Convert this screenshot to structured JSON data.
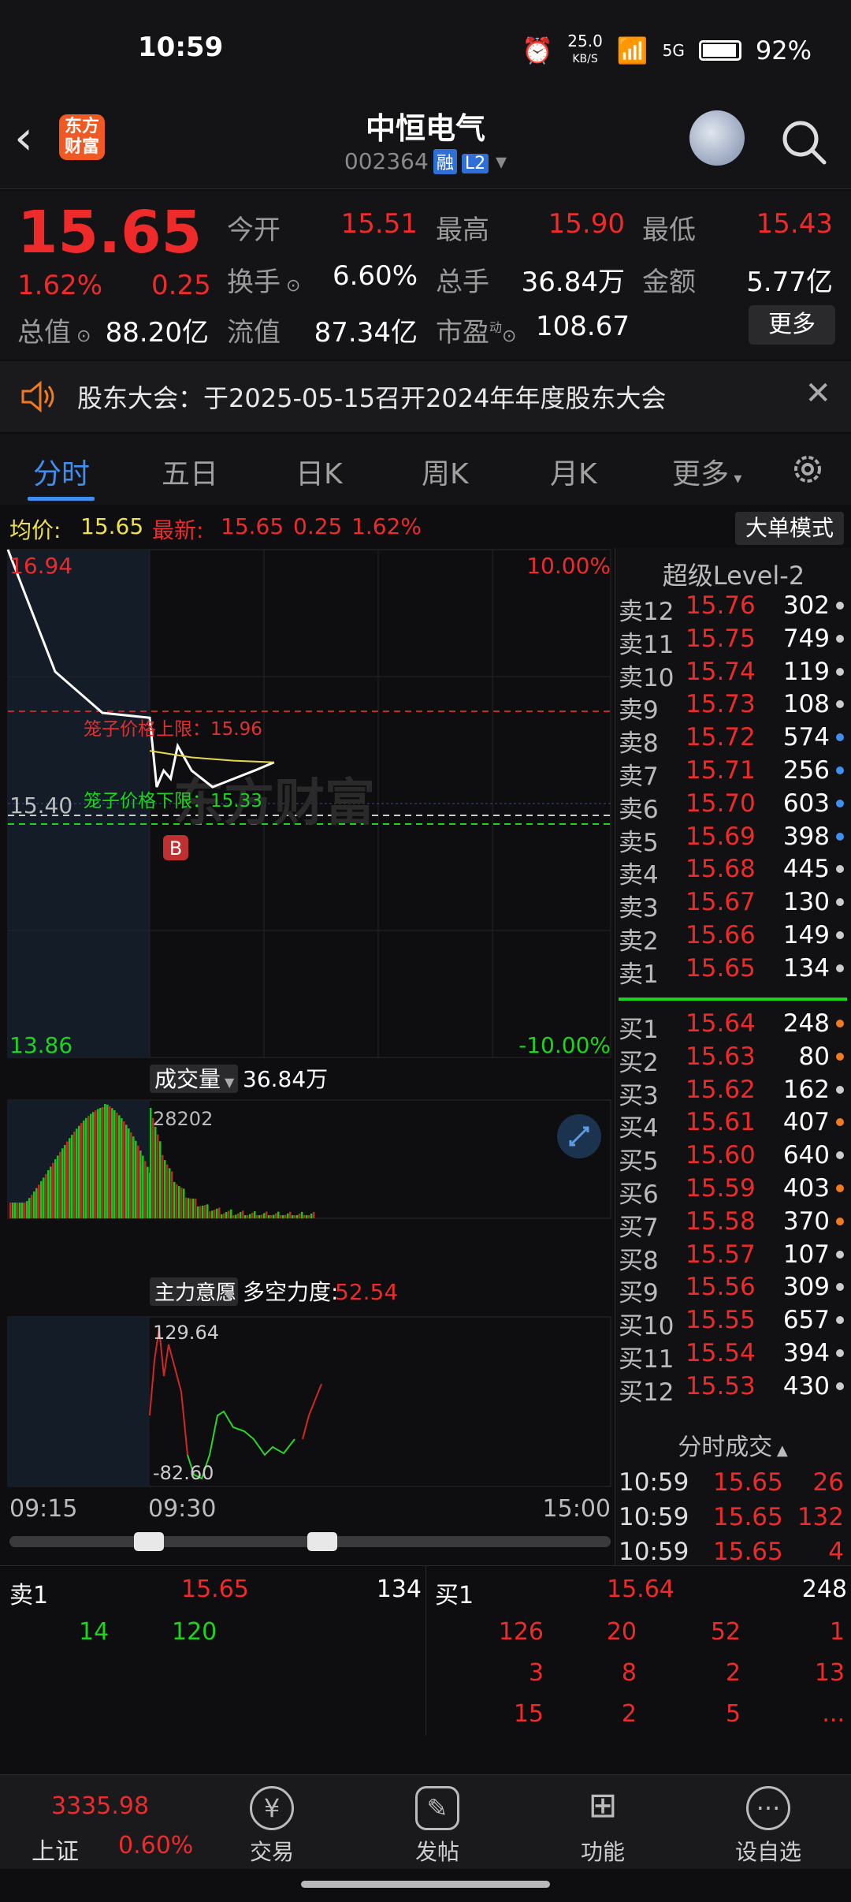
{
  "status_bar": {
    "time": "10:59",
    "net_speed": "25.0",
    "net_unit": "KB/S",
    "signal": "5G",
    "battery": "92%"
  },
  "header": {
    "name": "中恒电气",
    "code": "002364",
    "tag_rong": "融",
    "tag_l2": "L2",
    "logo_text": "东方财富"
  },
  "quote": {
    "price": "15.65",
    "pct": "1.62%",
    "change": "0.25",
    "open_label": "今开",
    "open": "15.51",
    "high_label": "最高",
    "high": "15.90",
    "low_label": "最低",
    "low": "15.43",
    "turnover_label": "换手",
    "turnover": "6.60%",
    "volume_label": "总手",
    "volume": "36.84万",
    "amount_label": "金额",
    "amount": "5.77亿",
    "mktcap_label": "总值",
    "mktcap": "88.20亿",
    "float_label": "流值",
    "float": "87.34亿",
    "pe_label": "市盈",
    "pe_sup": "动",
    "pe": "108.67",
    "more": "更多"
  },
  "notice": {
    "text": "股东大会：于2025-05-15召开2024年年度股东大会"
  },
  "tabs": [
    "分时",
    "五日",
    "日K",
    "周K",
    "月K",
    "更多"
  ],
  "info_row": {
    "avg_label": "均价:",
    "avg": "15.65",
    "latest_label": "最新:",
    "latest": "15.65",
    "chg": "0.25",
    "pct": "1.62%",
    "mode_button": "大单模式"
  },
  "chart": {
    "y_top": "16.94",
    "y_mid": "15.40",
    "y_bottom": "13.86",
    "pct_top": "10.00%",
    "pct_bottom": "-10.00%",
    "cage_upper": "笼子价格上限：15.96",
    "cage_lower": "笼子价格下限：15.33",
    "marker_b": "B",
    "watermark": "东方财富",
    "volume_label": "成交量",
    "volume_value": "36.84万",
    "volume_max": "28202",
    "force_label": "主力意愿",
    "force_title": "多空力度:",
    "force_value": "52.54",
    "force_max": "129.64",
    "force_min": "-82.60",
    "time_start": "09:15",
    "time_open": "09:30",
    "time_end": "15:00"
  },
  "chart_data": {
    "type": "line",
    "series": [
      {
        "name": "价格",
        "x": [
          "09:15",
          "09:20",
          "09:25",
          "09:30",
          "09:35",
          "09:40",
          "09:45",
          "09:50",
          "10:00",
          "10:15",
          "10:30",
          "10:45",
          "10:59"
        ],
        "values": [
          16.94,
          16.2,
          15.95,
          15.92,
          15.5,
          15.6,
          15.55,
          15.75,
          15.6,
          15.5,
          15.55,
          15.6,
          15.65
        ]
      },
      {
        "name": "均价",
        "x": [
          "09:30",
          "10:00",
          "10:30",
          "10:59"
        ],
        "values": [
          15.72,
          15.68,
          15.66,
          15.65
        ]
      }
    ],
    "ylim": [
      13.86,
      16.94
    ]
  },
  "order_book": {
    "title": "超级Level-2",
    "sell": [
      {
        "label": "卖12",
        "price": "15.76",
        "vol": "302",
        "dot": "#cccccc"
      },
      {
        "label": "卖11",
        "price": "15.75",
        "vol": "749",
        "dot": "#cccccc"
      },
      {
        "label": "卖10",
        "price": "15.74",
        "vol": "119",
        "dot": "#cccccc"
      },
      {
        "label": "卖9",
        "price": "15.73",
        "vol": "108",
        "dot": "#cccccc"
      },
      {
        "label": "卖8",
        "price": "15.72",
        "vol": "574",
        "dot": "#3f8ff0"
      },
      {
        "label": "卖7",
        "price": "15.71",
        "vol": "256",
        "dot": "#3f8ff0"
      },
      {
        "label": "卖6",
        "price": "15.70",
        "vol": "603",
        "dot": "#3f8ff0"
      },
      {
        "label": "卖5",
        "price": "15.69",
        "vol": "398",
        "dot": "#3f8ff0"
      },
      {
        "label": "卖4",
        "price": "15.68",
        "vol": "445",
        "dot": "#cccccc"
      },
      {
        "label": "卖3",
        "price": "15.67",
        "vol": "130",
        "dot": "#cccccc"
      },
      {
        "label": "卖2",
        "price": "15.66",
        "vol": "149",
        "dot": "#cccccc"
      },
      {
        "label": "卖1",
        "price": "15.65",
        "vol": "134",
        "dot": "#cccccc"
      }
    ],
    "buy": [
      {
        "label": "买1",
        "price": "15.64",
        "vol": "248",
        "dot": "#f07a22"
      },
      {
        "label": "买2",
        "price": "15.63",
        "vol": "80",
        "dot": "#f07a22"
      },
      {
        "label": "买3",
        "price": "15.62",
        "vol": "162",
        "dot": "#cccccc"
      },
      {
        "label": "买4",
        "price": "15.61",
        "vol": "407",
        "dot": "#f07a22"
      },
      {
        "label": "买5",
        "price": "15.60",
        "vol": "640",
        "dot": "#cccccc"
      },
      {
        "label": "买6",
        "price": "15.59",
        "vol": "403",
        "dot": "#f07a22"
      },
      {
        "label": "买7",
        "price": "15.58",
        "vol": "370",
        "dot": "#f07a22"
      },
      {
        "label": "买8",
        "price": "15.57",
        "vol": "107",
        "dot": "#cccccc"
      },
      {
        "label": "买9",
        "price": "15.56",
        "vol": "309",
        "dot": "#cccccc"
      },
      {
        "label": "买10",
        "price": "15.55",
        "vol": "657",
        "dot": "#cccccc"
      },
      {
        "label": "买11",
        "price": "15.54",
        "vol": "394",
        "dot": "#cccccc"
      },
      {
        "label": "买12",
        "price": "15.53",
        "vol": "430",
        "dot": "#cccccc"
      }
    ],
    "ticks_title": "分时成交",
    "ticks": [
      {
        "time": "10:59",
        "price": "15.65",
        "vol": "26"
      },
      {
        "time": "10:59",
        "price": "15.65",
        "vol": "132"
      },
      {
        "time": "10:59",
        "price": "15.65",
        "vol": "4"
      }
    ]
  },
  "bottom_book": {
    "sell_label": "卖1",
    "sell_price": "15.65",
    "sell_vol": "134",
    "buy_label": "买1",
    "buy_price": "15.64",
    "buy_vol": "248",
    "sell_queue": [
      "14",
      "120"
    ],
    "buy_queue": [
      [
        "126",
        "20",
        "52",
        "1"
      ],
      [
        "3",
        "8",
        "2",
        "13"
      ],
      [
        "15",
        "2",
        "5",
        "..."
      ]
    ]
  },
  "nav": {
    "index_value": "3335.98",
    "index_name": "上证",
    "index_pct": "0.60%",
    "items": [
      "交易",
      "发帖",
      "功能",
      "设自选"
    ]
  }
}
